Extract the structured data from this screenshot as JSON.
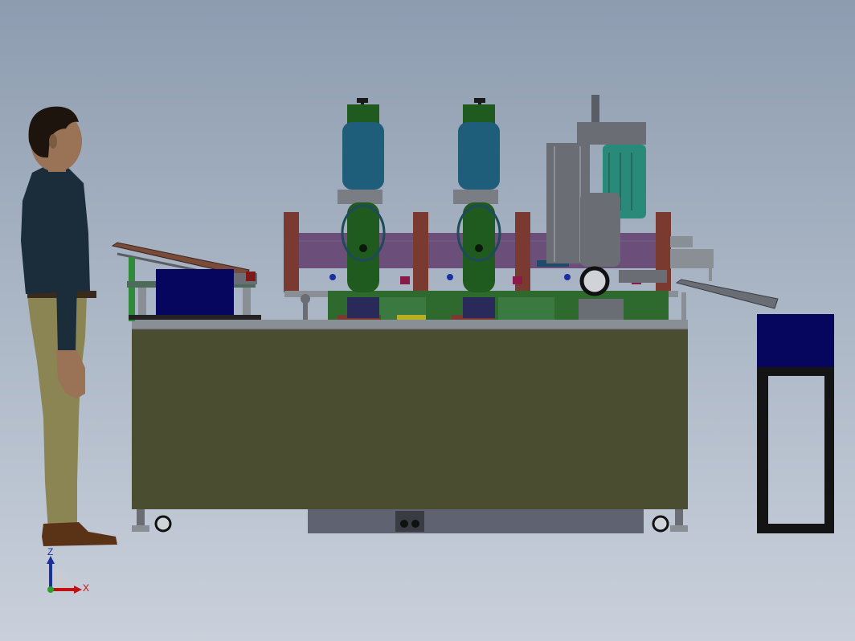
{
  "view": {
    "type": "cad-3d-assembly-side-view",
    "background_top": "#8d9cb0",
    "background_bottom": "#c9d0db"
  },
  "triad": {
    "z_label": "Z",
    "x_label": "X",
    "z_color": "#1a2fa0",
    "x_color": "#c01010",
    "origin_color": "#2aa02a"
  },
  "colors": {
    "table_body": "#4b4d31",
    "table_top": "#8a8f96",
    "purple_beam": "#6b4f7a",
    "red_column": "#7a3a30",
    "green_spindle": "#1f5a1f",
    "blue_motor": "#1f5e7a",
    "teal_motor": "#2a8a7a",
    "navy_box": "#06065e",
    "gray_housing": "#6a6d73",
    "figure_shirt": "#1b2c3a",
    "figure_pants": "#8a8553",
    "figure_skin": "#9a7256",
    "figure_shoes": "#5a3216",
    "stand_frame": "#141414"
  }
}
